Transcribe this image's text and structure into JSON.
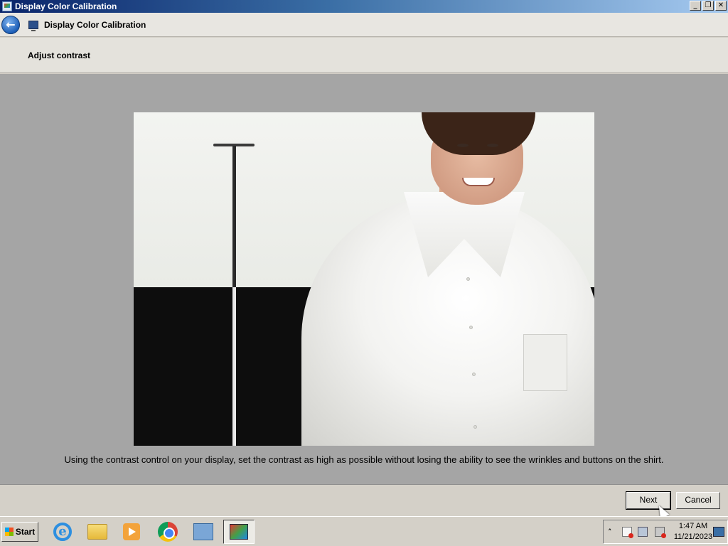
{
  "window": {
    "title": "Display Color Calibration",
    "controls": {
      "minimize": "_",
      "restore": "❐",
      "close": "✕"
    }
  },
  "nav": {
    "back_glyph": "←",
    "title": "Display Color Calibration"
  },
  "page": {
    "heading": "Adjust contrast",
    "instruction": "Using the contrast control on your display, set the contrast as high as possible without losing the ability to see the wrinkles and buttons on the shirt."
  },
  "buttons": {
    "next": "Next",
    "cancel": "Cancel"
  },
  "taskbar": {
    "start_label": "Start",
    "pinned": [
      "internet-explorer-icon",
      "folder-icon",
      "media-player-icon",
      "chrome-icon",
      "server-manager-icon",
      "display-calibration-icon"
    ],
    "ie_glyph": "e"
  },
  "tray": {
    "chevron": "˄",
    "time": "1:47 AM",
    "date": "11/21/2023"
  }
}
